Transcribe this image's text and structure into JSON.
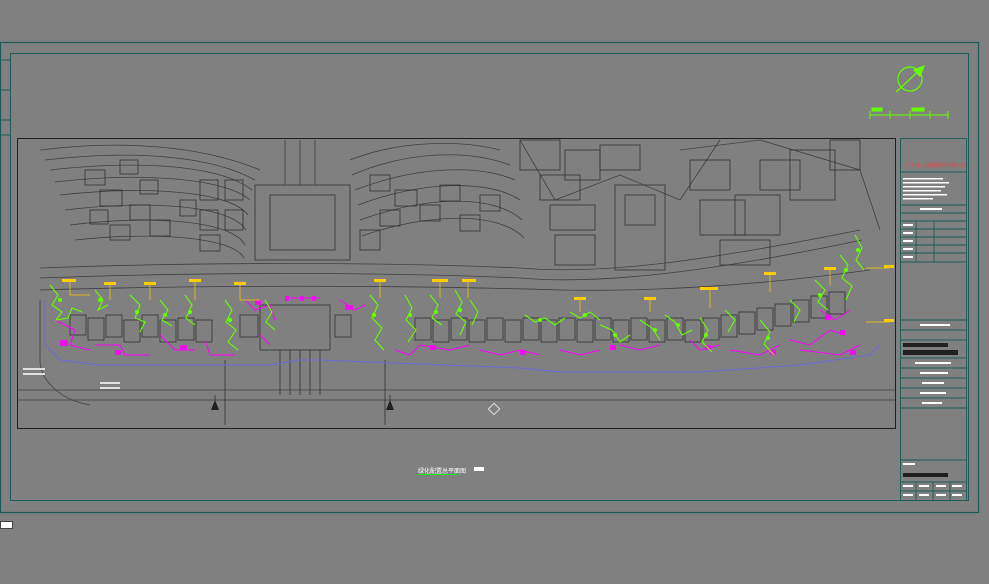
{
  "colors": {
    "background": "#808080",
    "frame": "#1d5a5a",
    "linework": "#404040",
    "planting": "#66ff00",
    "paving": "#ff00ff",
    "labels": "#ffcc00",
    "boundary": "#6b6bd6",
    "titleblock_red": "#ff3b3b",
    "text": "#ffffff"
  },
  "drawing": {
    "caption": "绿化配置总平面图",
    "company": "广州土人景观顾问有限公司",
    "north_arrow": "north-arrow-icon",
    "scale_bar": "scale-bar-icon"
  },
  "command_line": {
    "value": ""
  }
}
